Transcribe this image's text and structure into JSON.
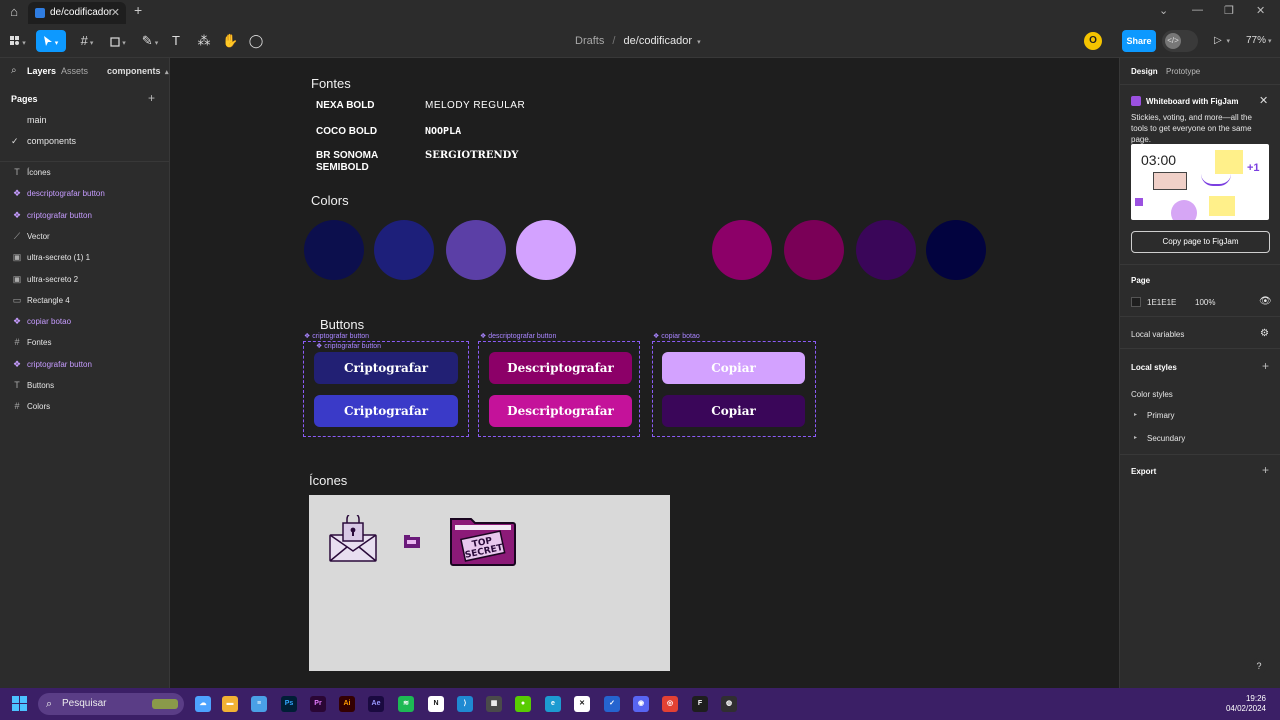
{
  "browser": {
    "tab_title": "de/codificador",
    "close_glyph": "✕",
    "new_tab_glyph": "+",
    "window_controls": [
      "⌄",
      "—",
      "❐",
      "✕"
    ]
  },
  "toolbar": {
    "breadcrumb_root": "Drafts",
    "breadcrumb_sep": "/",
    "file_name": "de/codificador",
    "avatar_initial": "O",
    "share_label": "Share",
    "zoom": "77%",
    "tools": [
      "main-menu-icon",
      "move-icon",
      "frame-icon",
      "rectangle-icon",
      "pen-icon",
      "text-icon",
      "resources-icon",
      "hand-icon",
      "comment-icon"
    ]
  },
  "left_panel": {
    "tab_layers": "Layers",
    "tab_assets": "Assets",
    "page_selector": "components",
    "pages_heading": "Pages",
    "pages": [
      "main",
      "components"
    ],
    "layers": [
      {
        "label": "Ícones",
        "icon": "text-layer-icon",
        "component": false
      },
      {
        "label": "descriptografar button",
        "icon": "component-icon",
        "component": true
      },
      {
        "label": "criptografar button",
        "icon": "component-icon",
        "component": true
      },
      {
        "label": "Vector",
        "icon": "vector-icon",
        "component": false
      },
      {
        "label": "ultra-secreto (1) 1",
        "icon": "image-icon",
        "component": false
      },
      {
        "label": "ultra-secreto 2",
        "icon": "image-icon",
        "component": false
      },
      {
        "label": "Rectangle 4",
        "icon": "rectangle-icon",
        "component": false
      },
      {
        "label": "copiar botao",
        "icon": "component-icon",
        "component": true
      },
      {
        "label": "Fontes",
        "icon": "frame-icon",
        "component": false
      },
      {
        "label": "criptografar button",
        "icon": "component-icon",
        "component": true
      },
      {
        "label": "Buttons",
        "icon": "text-layer-icon",
        "component": false
      },
      {
        "label": "Colors",
        "icon": "frame-icon",
        "component": false
      }
    ]
  },
  "canvas": {
    "fonts_title": "Fontes",
    "fonts": [
      "NEXA BOLD",
      "MELODY REGULAR",
      "COCO BOLD",
      "NOOPLA",
      "BR SONOMA SEMIBOLD",
      "SERGIOTRENDY"
    ],
    "colors_title": "Colors",
    "colors": [
      "#0c0f4d",
      "#1d1f7a",
      "#5b3fa6",
      "#d3a2ff",
      "#8c0068",
      "#7a0057",
      "#3a0659",
      "#02033f"
    ],
    "buttons_title": "Buttons",
    "frame_labels": [
      "criptografar button",
      "criptografar button",
      "descriptografar button",
      "copiar botao"
    ],
    "buttons": {
      "encrypt_1": "Criptografar",
      "encrypt_2": "Criptografar",
      "decrypt_1": "Descriptografar",
      "decrypt_2": "Descriptografar",
      "copy_1": "Copiar",
      "copy_2": "Copiar"
    },
    "button_colors": {
      "encrypt_1": "#222074",
      "encrypt_2": "#3a3ac8",
      "decrypt_1": "#8c0068",
      "decrypt_2": "#c4129a",
      "copy_1": "#d3a2ff",
      "copy_2": "#3a0659"
    },
    "icons_title": "Ícones",
    "top_secret_line1": "TOP",
    "top_secret_line2": "SECRET"
  },
  "right_panel": {
    "tab_design": "Design",
    "tab_prototype": "Prototype",
    "figjam_title": "Whiteboard with FigJam",
    "figjam_desc": "Stickies, voting, and more—all the tools to get everyone on the same page.",
    "figjam_timer": "03:00",
    "figjam_badge": "+1",
    "copy_button": "Copy page to FigJam",
    "page_heading": "Page",
    "page_color": "1E1E1E",
    "page_opacity": "100%",
    "local_variables": "Local variables",
    "local_styles": "Local styles",
    "color_styles": "Color styles",
    "style_groups": [
      "Primary",
      "Secundary"
    ],
    "export": "Export",
    "help": "?"
  },
  "taskbar": {
    "search_placeholder": "Pesquisar",
    "time": "19:26",
    "date": "04/02/2024",
    "apps": [
      "weather",
      "explorer",
      "notepad",
      "Ps",
      "Pr",
      "Ai",
      "Ae",
      "spotify",
      "N",
      "vscode",
      "calculator",
      "duolingo",
      "edge",
      "capcut",
      "todo",
      "discord",
      "chrome",
      "figma",
      "obs"
    ]
  }
}
